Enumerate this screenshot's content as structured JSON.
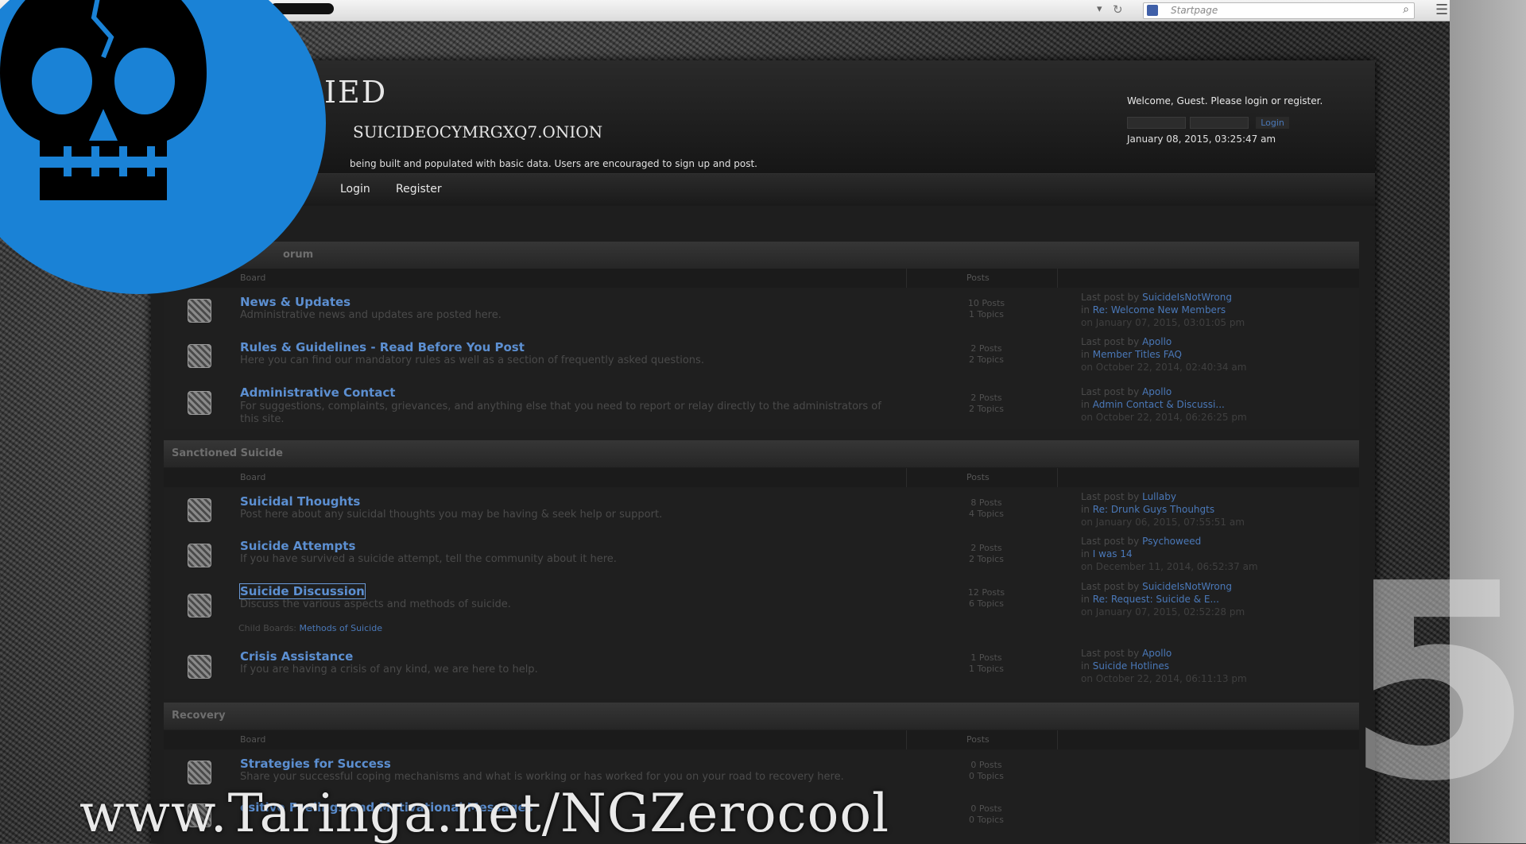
{
  "browser": {
    "search_placeholder": "Startpage"
  },
  "site": {
    "title_partial": "IED",
    "url_partial": "SUICIDEOCYMRGXQ7.ONION",
    "news": "being built and populated with basic data. Users are encouraged to sign up and post.",
    "welcome_text": "Welcome, Guest. Please login or register.",
    "login_button": "Login",
    "datetime": "January 08, 2015, 03:25:47 am"
  },
  "nav": {
    "items": [
      {
        "label": "Login"
      },
      {
        "label": "Register"
      }
    ]
  },
  "columns": {
    "board": "Board",
    "posts": "Posts"
  },
  "categories": [
    {
      "title": "orum",
      "boards": [
        {
          "name": "News & Updates",
          "desc": "Administrative news and updates are posted here.",
          "posts": "10 Posts",
          "topics": "1 Topics",
          "last_by": "SuicideIsNotWrong",
          "last_in": "Re: Welcome New Members",
          "last_on": "on January 07, 2015, 03:01:05 pm"
        },
        {
          "name": "Rules & Guidelines - Read Before You Post",
          "desc": "Here you can find our mandatory rules as well as a section of frequently asked questions.",
          "posts": "2 Posts",
          "topics": "2 Topics",
          "last_by": "Apollo",
          "last_in": "Member Titles FAQ",
          "last_on": "on October 22, 2014, 02:40:34 am"
        },
        {
          "name": "Administrative Contact",
          "desc": "For suggestions, complaints, grievances, and anything else that you need to report or relay directly to the administrators of this site.",
          "posts": "2 Posts",
          "topics": "2 Topics",
          "last_by": "Apollo",
          "last_in": "Admin Contact & Discussi...",
          "last_on": "on October 22, 2014, 06:26:25 pm"
        }
      ]
    },
    {
      "title": "Sanctioned Suicide",
      "boards": [
        {
          "name": "Suicidal Thoughts",
          "desc": "Post here about any suicidal thoughts you may be having & seek help or support.",
          "posts": "8 Posts",
          "topics": "4 Topics",
          "last_by": "Lullaby",
          "last_in": "Re: Drunk Guys Thouhgts",
          "last_on": "on January 06, 2015, 07:55:51 am"
        },
        {
          "name": "Suicide Attempts",
          "desc": "If you have survived a suicide attempt, tell the community about it here.",
          "posts": "2 Posts",
          "topics": "2 Topics",
          "last_by": "Psychoweed",
          "last_in": "I was 14",
          "last_on": "on December 11, 2014, 06:52:37 am"
        },
        {
          "name": "Suicide Discussion",
          "desc": "Discuss the various aspects and methods of suicide.",
          "posts": "12 Posts",
          "topics": "6 Topics",
          "last_by": "SuicideIsNotWrong",
          "last_in": "Re: Request: Suicide & E...",
          "last_on": "on January 07, 2015, 02:52:28 pm",
          "child_label": "Child Boards:",
          "child_link": "Methods of Suicide"
        },
        {
          "name": "Crisis Assistance",
          "desc": "If you are having a crisis of any kind, we are here to help.",
          "posts": "1 Posts",
          "topics": "1 Topics",
          "last_by": "Apollo",
          "last_in": "Suicide Hotlines",
          "last_on": "on October 22, 2014, 06:11:13 pm"
        }
      ]
    },
    {
      "title": "Recovery",
      "boards": [
        {
          "name": "Strategies for Success",
          "desc": "Share your successful coping mechanisms and what is working or has worked for you on your road to recovery here.",
          "posts": "0 Posts",
          "topics": "0 Topics"
        },
        {
          "name": "ositive Feelings and Motivational Messages",
          "desc": "",
          "posts": "0 Posts",
          "topics": "0 Topics"
        }
      ]
    }
  ],
  "last_post_prefix": "Last post by",
  "in_prefix": "in",
  "overlay": {
    "watermark": "www.Taringa.net/NGZerocool",
    "number": "5",
    "logo_color": "#1a82d6"
  }
}
